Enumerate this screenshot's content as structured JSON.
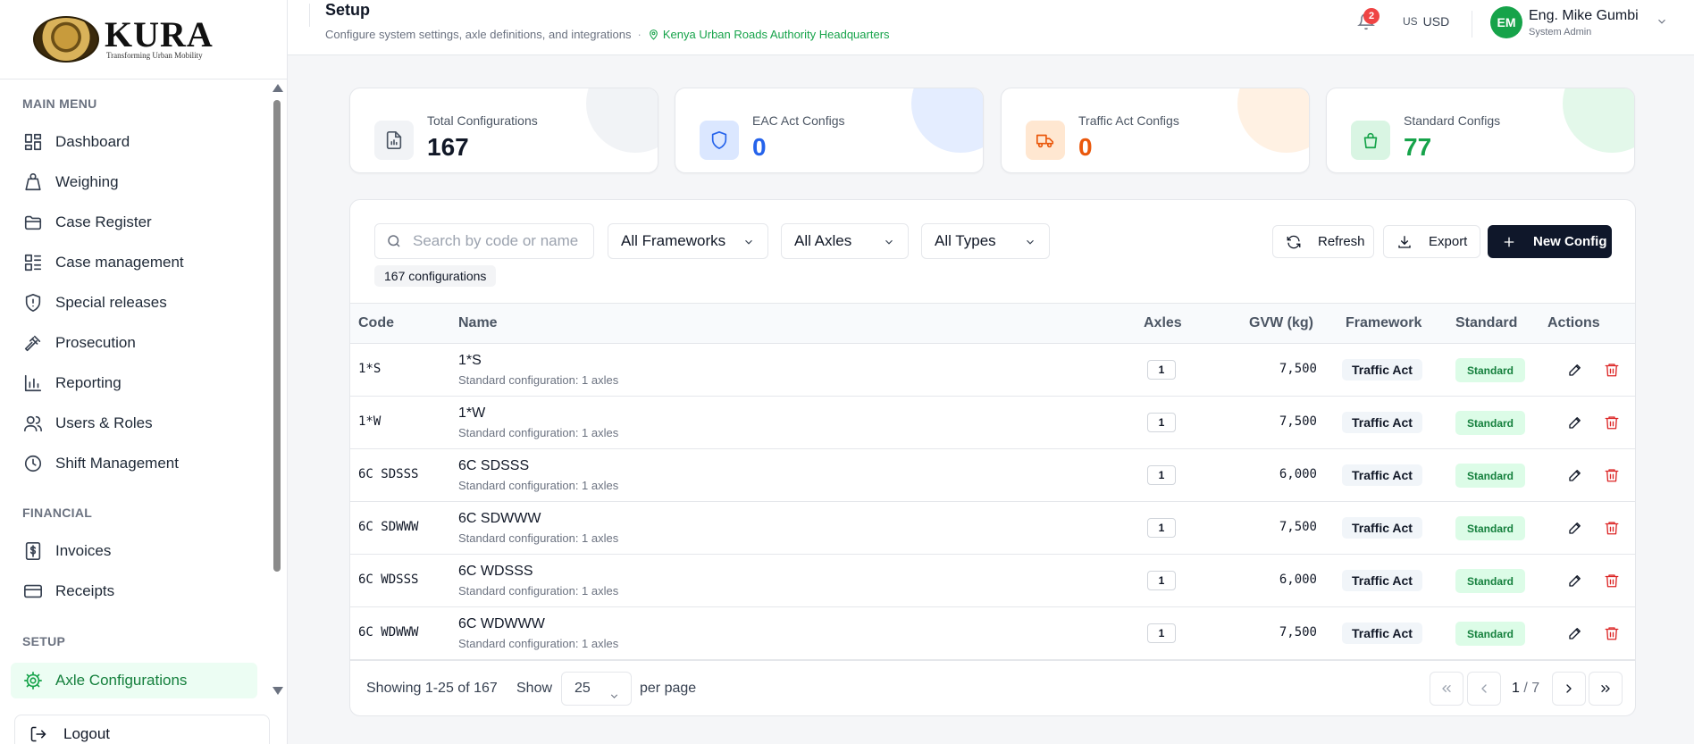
{
  "brand": {
    "name": "KURA",
    "tagline": "Transforming Urban Mobility"
  },
  "sidebar": {
    "sections": [
      {
        "title": "MAIN MENU",
        "items": [
          {
            "label": "Dashboard",
            "icon": "dashboard-icon"
          },
          {
            "label": "Weighing",
            "icon": "weight-icon"
          },
          {
            "label": "Case Register",
            "icon": "folder-icon"
          },
          {
            "label": "Case management",
            "icon": "list-icon"
          },
          {
            "label": "Special releases",
            "icon": "shield-alert-icon"
          },
          {
            "label": "Prosecution",
            "icon": "gavel-icon"
          },
          {
            "label": "Reporting",
            "icon": "bar-chart-icon"
          },
          {
            "label": "Users & Roles",
            "icon": "users-icon"
          },
          {
            "label": "Shift Management",
            "icon": "clock-icon"
          }
        ]
      },
      {
        "title": "FINANCIAL",
        "items": [
          {
            "label": "Invoices",
            "icon": "dollar-doc-icon"
          },
          {
            "label": "Receipts",
            "icon": "credit-card-icon"
          }
        ]
      },
      {
        "title": "SETUP",
        "items": [
          {
            "label": "Axle Configurations",
            "icon": "gear-icon",
            "active": true
          }
        ]
      }
    ],
    "logout_label": "Logout"
  },
  "header": {
    "title": "Setup",
    "subtitle": "Configure system settings, axle definitions, and integrations",
    "separator": "·",
    "location": "Kenya Urban Roads Authority Headquarters",
    "notifications": "2",
    "currency_flag": "US",
    "currency": "USD",
    "user_initials": "EM",
    "user_name": "Eng. Mike Gumbi",
    "user_role": "System Admin"
  },
  "stats": [
    {
      "label": "Total Configurations",
      "value": "167",
      "color": "#111827",
      "icon": "document-chart-icon"
    },
    {
      "label": "EAC Act Configs",
      "value": "0",
      "color": "#2563eb",
      "icon": "shield-icon"
    },
    {
      "label": "Traffic Act Configs",
      "value": "0",
      "color": "#ea580c",
      "icon": "truck-icon"
    },
    {
      "label": "Standard Configs",
      "value": "77",
      "color": "#16a34a",
      "icon": "bag-icon"
    }
  ],
  "toolbar": {
    "search_placeholder": "Search by code or name",
    "framework_filter": "All Frameworks",
    "axles_filter": "All Axles",
    "types_filter": "All Types",
    "count_badge": "167 configurations",
    "refresh_label": "Refresh",
    "export_label": "Export",
    "new_label": "New Config"
  },
  "table": {
    "columns": [
      "Code",
      "Name",
      "Axles",
      "GVW (kg)",
      "Framework",
      "Standard",
      "Actions"
    ],
    "rows": [
      {
        "code": "1*S",
        "name": "1*S",
        "desc": "Standard configuration: 1 axles",
        "axles": "1",
        "gvw": "7,500",
        "framework": "Traffic Act",
        "standard": "Standard"
      },
      {
        "code": "1*W",
        "name": "1*W",
        "desc": "Standard configuration: 1 axles",
        "axles": "1",
        "gvw": "7,500",
        "framework": "Traffic Act",
        "standard": "Standard"
      },
      {
        "code": "6C SDSSS",
        "name": "6C SDSSS",
        "desc": "Standard configuration: 1 axles",
        "axles": "1",
        "gvw": "6,000",
        "framework": "Traffic Act",
        "standard": "Standard"
      },
      {
        "code": "6C SDWWW",
        "name": "6C SDWWW",
        "desc": "Standard configuration: 1 axles",
        "axles": "1",
        "gvw": "7,500",
        "framework": "Traffic Act",
        "standard": "Standard"
      },
      {
        "code": "6C WDSSS",
        "name": "6C WDSSS",
        "desc": "Standard configuration: 1 axles",
        "axles": "1",
        "gvw": "6,000",
        "framework": "Traffic Act",
        "standard": "Standard"
      },
      {
        "code": "6C WDWWW",
        "name": "6C WDWWW",
        "desc": "Standard configuration: 1 axles",
        "axles": "1",
        "gvw": "7,500",
        "framework": "Traffic Act",
        "standard": "Standard"
      }
    ]
  },
  "pagination": {
    "showing": "Showing 1-25 of 167",
    "show_label": "Show",
    "per_page_value": "25",
    "per_page_label": "per page",
    "current_page": "1",
    "total_pages": "/ 7"
  }
}
